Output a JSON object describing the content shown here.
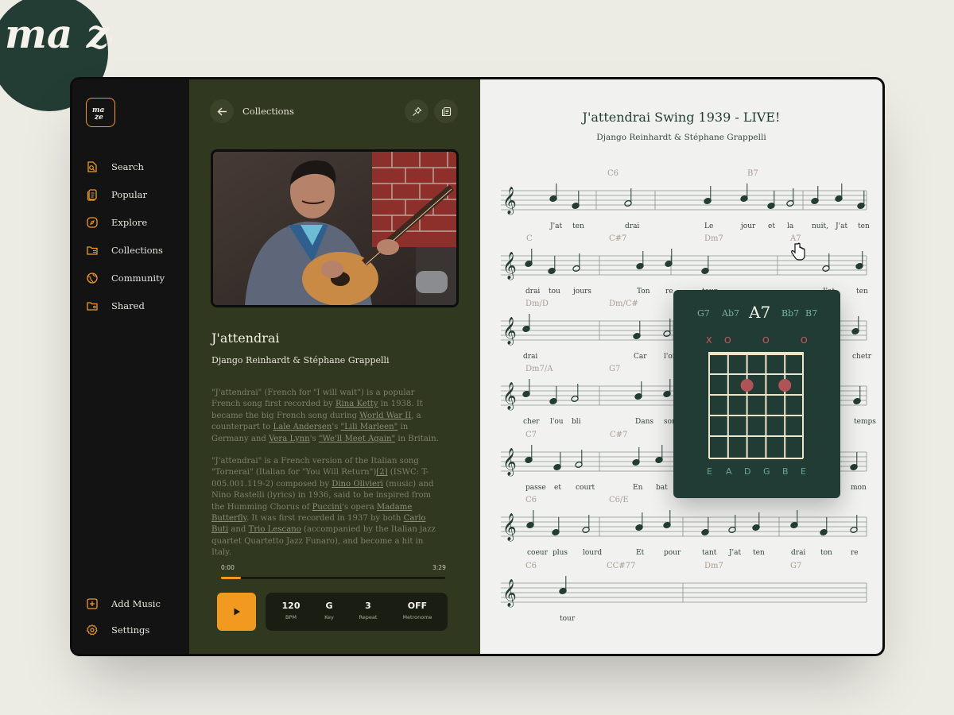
{
  "brand": {
    "logo_text": "ma ze"
  },
  "sidebar": {
    "items": [
      {
        "label": "Search",
        "icon": "search-icon"
      },
      {
        "label": "Popular",
        "icon": "popular-icon"
      },
      {
        "label": "Explore",
        "icon": "explore-icon"
      },
      {
        "label": "Collections",
        "icon": "collections-icon"
      },
      {
        "label": "Community",
        "icon": "community-icon"
      },
      {
        "label": "Shared",
        "icon": "shared-folder-icon"
      }
    ],
    "bottom": [
      {
        "label": "Add Music",
        "icon": "plus-icon"
      },
      {
        "label": "Settings",
        "icon": "gear-icon"
      }
    ]
  },
  "header": {
    "breadcrumb": "Collections"
  },
  "song": {
    "title": "J'attendrai",
    "artist": "Django Reinhardt & Stéphane Grappelli",
    "description": [
      [
        {
          "t": "\"J'attendrai\" (French for \"I will wait\") is a popular French song first recorded by "
        },
        {
          "t": "Rina Ketty",
          "link": true
        },
        {
          "t": " in 1938. It became the big French song during "
        },
        {
          "t": "World War II",
          "link": true
        },
        {
          "t": ", a counterpart to "
        },
        {
          "t": "Lale Andersen",
          "link": true
        },
        {
          "t": "'s "
        },
        {
          "t": "\"Lili Marleen\"",
          "link": true
        },
        {
          "t": " in Germany and "
        },
        {
          "t": "Vera Lynn",
          "link": true
        },
        {
          "t": "'s "
        },
        {
          "t": "\"We'll Meet Again\"",
          "link": true
        },
        {
          "t": " in Britain."
        }
      ],
      [
        {
          "t": "\"J'attendrai\" is a French version of the Italian song \"Tornerai\" (Italian for \"You Will Return\")"
        },
        {
          "t": "[2]",
          "link": true
        },
        {
          "t": " (ISWC: T-005.001.119-2) composed by "
        },
        {
          "t": "Dino Olivieri",
          "link": true
        },
        {
          "t": " (music) and Nino Rastelli (lyrics) in 1936, said to be inspired from the Humming Chorus of "
        },
        {
          "t": "Puccini",
          "link": true
        },
        {
          "t": "'s opera "
        },
        {
          "t": "Madame Butterfly",
          "link": true
        },
        {
          "t": ". It was first recorded in 1937 by both "
        },
        {
          "t": "Carlo Buti",
          "link": true
        },
        {
          "t": " and "
        },
        {
          "t": "Trio Lescano",
          "link": true
        },
        {
          "t": " (accompanied by the Italian jazz quartet Quartetto Jazz Funaro), and become a hit in Italy."
        }
      ]
    ]
  },
  "player": {
    "current_time": "0:00",
    "duration": "3:29",
    "progress": 0.09,
    "controls": [
      {
        "value": "120",
        "label": "BPM"
      },
      {
        "value": "G",
        "label": "Key"
      },
      {
        "value": "3",
        "label": "Repeat"
      },
      {
        "value": "OFF",
        "label": "Metronome"
      }
    ]
  },
  "sheet": {
    "title": "J'attendrai Swing 1939 - LIVE!",
    "subtitle": "Django Reinhardt & Stéphane Grappelli",
    "systems": [
      {
        "chords": [
          "C6",
          "B7"
        ],
        "lyrics": [
          "J'at",
          "ten",
          "drai",
          "Le",
          "jour",
          "et",
          "la",
          "nuit,",
          "J'at",
          "ten"
        ]
      },
      {
        "chords": [
          "C",
          "C#7",
          "Dm7",
          "A7"
        ],
        "lyrics": [
          "drai",
          "tou",
          "jours",
          "Ton",
          "re",
          "tour",
          "J'at",
          "ten"
        ]
      },
      {
        "chords": [
          "Dm/D",
          "Dm/C#"
        ],
        "lyrics": [
          "drai",
          "Car",
          "l'oi",
          "chetr"
        ]
      },
      {
        "chords": [
          "Dm7/A",
          "G7"
        ],
        "lyrics": [
          "cher",
          "l'ou",
          "bli",
          "Dans",
          "son",
          "temps"
        ]
      },
      {
        "chords": [
          "C7",
          "C#7"
        ],
        "lyrics": [
          "passe",
          "et",
          "court",
          "En",
          "bat",
          "mon"
        ]
      },
      {
        "chords": [
          "C6",
          "C6/E"
        ],
        "lyrics": [
          "coeur",
          "plus",
          "lourd",
          "Et",
          "pour",
          "tant",
          "J'at",
          "ten",
          "drai",
          "ton",
          "re"
        ]
      },
      {
        "chords": [
          "C6",
          "CC#77",
          "Dm7",
          "G7"
        ],
        "lyrics": [
          "tour"
        ]
      }
    ]
  },
  "chord_popup": {
    "options": [
      "G7",
      "Ab7",
      "A7",
      "Bb7",
      "B7"
    ],
    "selected": "A7",
    "string_marks": [
      "X",
      "O",
      "O",
      "O"
    ],
    "strings": [
      "E",
      "A",
      "D",
      "G",
      "B",
      "E"
    ]
  },
  "colors": {
    "accent": "#f29a1f",
    "panel": "#30381f",
    "sheet_ink": "#233d34",
    "popup": "#213c35",
    "dot": "#b05357"
  }
}
